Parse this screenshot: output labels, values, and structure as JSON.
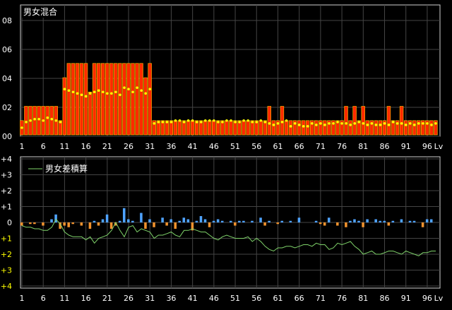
{
  "chart_data": [
    {
      "type": "bar",
      "title": "男女混合",
      "x_tick_labels": [
        "1",
        "6",
        "11",
        "16",
        "21",
        "26",
        "31",
        "36",
        "41",
        "46",
        "51",
        "56",
        "61",
        "66",
        "71",
        "76",
        "81",
        "86",
        "91",
        "96",
        "Lv"
      ],
      "y_tick_labels": [
        "00",
        "02",
        "04",
        "06",
        "08"
      ],
      "ylim": [
        0,
        8
      ],
      "xlim": [
        1,
        98
      ],
      "grid": true,
      "series": [
        {
          "kind": "bar",
          "color": "#ff2a00",
          "values": [
            1,
            2,
            2,
            2,
            2,
            2,
            2,
            2,
            2,
            1,
            4,
            5,
            5,
            5,
            5,
            5,
            3,
            5,
            5,
            5,
            5,
            5,
            5,
            5,
            5,
            5,
            5,
            5,
            5,
            4,
            5,
            1,
            1,
            1,
            1,
            1,
            1,
            1,
            1,
            1,
            1,
            1,
            1,
            1,
            1,
            1,
            1,
            1,
            1,
            1,
            1,
            1,
            1,
            1,
            1,
            1,
            1,
            1,
            2,
            1,
            1,
            2,
            1,
            1,
            1,
            1,
            1,
            1,
            1,
            1,
            1,
            1,
            1,
            1,
            1,
            1,
            2,
            1,
            2,
            1,
            2,
            1,
            1,
            1,
            1,
            1,
            2,
            1,
            1,
            2,
            1,
            1,
            1,
            1,
            1,
            1,
            1,
            1
          ]
        },
        {
          "kind": "dots",
          "color": "#ffff00",
          "values": [
            0.5,
            0.9,
            1.0,
            1.1,
            1.1,
            1.0,
            1.2,
            1.1,
            1.0,
            0.9,
            3.2,
            3.1,
            3.0,
            2.9,
            2.8,
            2.7,
            2.9,
            3.0,
            3.1,
            3.0,
            2.9,
            2.9,
            3.0,
            2.8,
            3.3,
            3.2,
            3.0,
            3.3,
            3.1,
            2.9,
            3.2,
            0.8,
            0.9,
            0.9,
            0.9,
            0.9,
            1.0,
            1.0,
            0.9,
            1.0,
            1.0,
            0.9,
            0.9,
            1.0,
            1.0,
            1.0,
            0.9,
            0.9,
            1.0,
            1.0,
            0.9,
            0.9,
            1.0,
            1.0,
            0.9,
            0.9,
            1.0,
            0.9,
            0.8,
            0.7,
            0.8,
            0.9,
            1.0,
            0.6,
            0.8,
            0.7,
            0.6,
            0.6,
            0.8,
            0.7,
            0.8,
            0.7,
            0.8,
            0.8,
            0.9,
            0.8,
            0.8,
            0.7,
            0.8,
            0.9,
            0.8,
            0.7,
            0.8,
            0.7,
            0.7,
            0.8,
            0.7,
            0.9,
            0.8,
            0.8,
            0.7,
            0.8,
            0.7,
            0.8,
            0.8,
            0.8,
            0.7,
            0.8
          ]
        }
      ]
    },
    {
      "type": "bar",
      "title": "男女差積算",
      "x_tick_labels": [
        "1",
        "6",
        "11",
        "16",
        "21",
        "26",
        "31",
        "36",
        "41",
        "46",
        "51",
        "56",
        "61",
        "66",
        "71",
        "76",
        "81",
        "86",
        "91",
        "96",
        "Lv"
      ],
      "y_tick_labels": [
        "+4",
        "+3",
        "+2",
        "+1",
        "0",
        "+1",
        "+2",
        "+3",
        "+4"
      ],
      "ylim": [
        -4,
        4
      ],
      "xlim": [
        1,
        98
      ],
      "grid": true,
      "series": [
        {
          "kind": "bar",
          "name": "男女差",
          "pos_color": "#4fa3ff",
          "neg_color": "#f0922e",
          "values": [
            -0.2,
            0,
            -0.1,
            0,
            0,
            -0.2,
            0,
            0,
            0.2,
            0.5,
            -0.4,
            -0.2,
            -0.3,
            -0.1,
            0,
            -0.2,
            0,
            -0.4,
            0.1,
            0,
            -0.2,
            0.2,
            0.5,
            0,
            -0.4,
            -0.2,
            0.1,
            0.9,
            0.2,
            0.1,
            0.6,
            -0.4,
            0.2,
            -0.3,
            0.3,
            -0.2,
            0.2,
            -0.4,
            0.1,
            0.3,
            0.2,
            -0.5,
            0.1,
            0.4,
            0.2,
            -0.3,
            0.1,
            0.2,
            0.1,
            -0.2,
            0,
            0.1,
            0,
            0,
            0.1,
            -0.2,
            0.1,
            0,
            0.1,
            0,
            -0.1,
            0.1,
            0,
            0.1,
            0,
            0.1,
            0.3,
            0,
            0,
            0.1,
            -0.1,
            -0.2,
            0.3,
            0,
            0.1,
            -0.2,
            -0.3,
            0.1,
            0.2,
            0.1,
            -0.3,
            0.2,
            0,
            0.2,
            0.1,
            0.1,
            -0.2,
            0.1,
            0,
            0.2,
            0,
            0.1,
            0.1,
            0,
            -0.3,
            0.2,
            0.2,
            0
          ],
          "bars": [
            [
              1,
              -0.2
            ],
            [
              3,
              -0.1
            ],
            [
              4,
              -0.1
            ],
            [
              6,
              -0.2
            ],
            [
              8,
              0.2
            ],
            [
              9,
              0.5
            ],
            [
              10,
              -0.4
            ],
            [
              11,
              -0.2
            ],
            [
              12,
              -0.3
            ],
            [
              13,
              -0.1
            ],
            [
              15,
              -0.2
            ],
            [
              17,
              -0.4
            ],
            [
              18,
              0.1
            ],
            [
              19,
              -0.2
            ],
            [
              20,
              0.2
            ],
            [
              21,
              0.5
            ],
            [
              22,
              -0.4
            ],
            [
              23,
              -0.2
            ],
            [
              24,
              0.1
            ],
            [
              25,
              0.9
            ],
            [
              26,
              0.2
            ],
            [
              27,
              0.1
            ],
            [
              29,
              0.6
            ],
            [
              30,
              -0.4
            ],
            [
              31,
              0.2
            ],
            [
              32,
              -0.3
            ],
            [
              34,
              0.3
            ],
            [
              35,
              -0.2
            ],
            [
              36,
              0.2
            ],
            [
              37,
              -0.4
            ],
            [
              38,
              0.1
            ],
            [
              39,
              0.3
            ],
            [
              40,
              0.2
            ],
            [
              41,
              -0.5
            ],
            [
              42,
              0.1
            ],
            [
              43,
              0.4
            ],
            [
              44,
              0.2
            ],
            [
              45,
              -0.3
            ],
            [
              46,
              0.1
            ],
            [
              47,
              0.2
            ],
            [
              48,
              0.1
            ],
            [
              50,
              0.1
            ],
            [
              51,
              -0.2
            ],
            [
              52,
              0.1
            ],
            [
              53,
              0.1
            ],
            [
              55,
              0.1
            ],
            [
              57,
              0.3
            ],
            [
              58,
              -0.2
            ],
            [
              59,
              0.1
            ],
            [
              61,
              -0.1
            ],
            [
              62,
              0.1
            ],
            [
              64,
              0.1
            ],
            [
              66,
              0.3
            ],
            [
              70,
              0.1
            ],
            [
              71,
              -0.1
            ],
            [
              72,
              -0.2
            ],
            [
              73,
              0.3
            ],
            [
              75,
              -0.2
            ],
            [
              77,
              -0.3
            ],
            [
              78,
              0.1
            ],
            [
              79,
              0.2
            ],
            [
              80,
              0.1
            ],
            [
              81,
              -0.3
            ],
            [
              82,
              0.2
            ],
            [
              84,
              0.2
            ],
            [
              85,
              0.1
            ],
            [
              86,
              0.1
            ],
            [
              87,
              -0.2
            ],
            [
              88,
              0.1
            ],
            [
              90,
              0.2
            ],
            [
              92,
              0.1
            ],
            [
              93,
              0.1
            ],
            [
              95,
              -0.3
            ],
            [
              96,
              0.2
            ],
            [
              97,
              0.2
            ]
          ]
        },
        {
          "kind": "line",
          "name": "男女差積算",
          "color": "#7fd36a",
          "values": [
            -0.2,
            -0.3,
            -0.3,
            -0.4,
            -0.4,
            -0.5,
            -0.5,
            -0.3,
            0.2,
            -0.1,
            -0.6,
            -0.8,
            -0.9,
            -0.9,
            -0.9,
            -1.1,
            -0.9,
            -1.3,
            -1.0,
            -0.9,
            -0.8,
            -0.5,
            0,
            -0.5,
            -0.9,
            -0.3,
            -0.2,
            -0.6,
            -0.4,
            -0.5,
            -0.6,
            -1.0,
            -0.8,
            -0.8,
            -0.7,
            -0.6,
            -0.8,
            -0.9,
            -0.5,
            -0.5,
            -0.4,
            -0.5,
            -0.6,
            -0.6,
            -0.8,
            -1.0,
            -1.1,
            -0.9,
            -0.8,
            -0.9,
            -1.0,
            -1.0,
            -1.0,
            -0.9,
            -1.2,
            -1.0,
            -1.2,
            -1.5,
            -1.7,
            -1.8,
            -1.6,
            -1.6,
            -1.5,
            -1.5,
            -1.6,
            -1.5,
            -1.4,
            -1.4,
            -1.5,
            -1.3,
            -1.4,
            -1.4,
            -1.7,
            -1.6,
            -1.3,
            -1.4,
            -1.3,
            -1.2,
            -1.5,
            -1.7,
            -2.0,
            -1.9,
            -1.8,
            -2.0,
            -2.0,
            -1.9,
            -1.8,
            -1.8,
            -1.9,
            -2.0,
            -1.8,
            -1.9,
            -2.0,
            -2.1,
            -1.9,
            -1.9,
            -1.8,
            -1.8
          ]
        }
      ]
    }
  ]
}
